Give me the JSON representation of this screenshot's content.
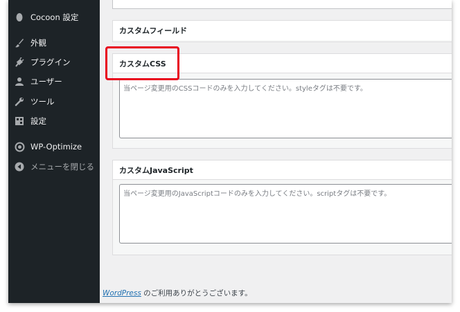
{
  "sidebar": {
    "items": [
      {
        "label": "Cocoon 設定",
        "icon": "cocoon-icon"
      },
      {
        "label": "外観",
        "icon": "brush-icon"
      },
      {
        "label": "プラグイン",
        "icon": "plugin-icon"
      },
      {
        "label": "ユーザー",
        "icon": "user-icon"
      },
      {
        "label": "ツール",
        "icon": "wrench-icon"
      },
      {
        "label": "設定",
        "icon": "settings-icon"
      },
      {
        "label": "WP-Optimize",
        "icon": "wp-optimize-icon"
      },
      {
        "label": "メニューを閉じる",
        "icon": "collapse-icon"
      }
    ]
  },
  "panels": {
    "custom_field": {
      "title": "カスタムフィールド"
    },
    "custom_css": {
      "title": "カスタムCSS",
      "placeholder": "当ページ変更用のCSSコードのみを入力してください。styleタグは不要です。"
    },
    "custom_js": {
      "title": "カスタムJavaScript",
      "placeholder": "当ページ変更用のJavaScriptコードのみを入力してください。scriptタグは不要です。"
    }
  },
  "footer": {
    "link": "WordPress",
    "text": " のご利用ありがとうございます。"
  },
  "colors": {
    "highlight": "#e8001c",
    "sidebar_bg": "#1d2327",
    "link": "#2271b1"
  }
}
